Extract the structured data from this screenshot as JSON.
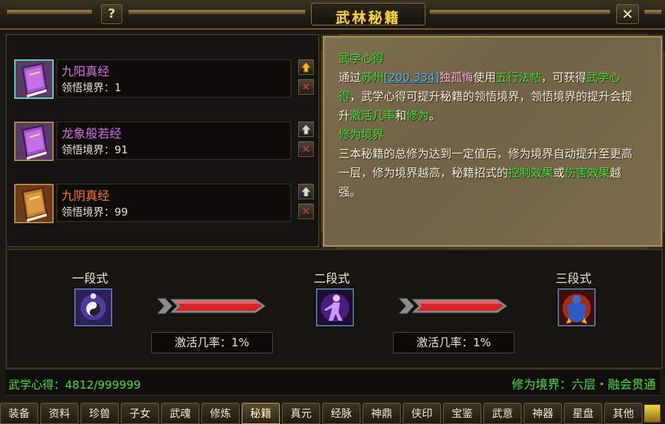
{
  "window": {
    "title": "武林秘籍",
    "help_label": "?",
    "close_label": "✕"
  },
  "books": [
    {
      "name": "九阳真经",
      "name_color": "#d86ee8",
      "level_label": "领悟境界：1",
      "icon": "purple-book-icon",
      "selected": true,
      "arrow": "up-arrow-gold"
    },
    {
      "name": "龙象般若经",
      "name_color": "#d86ee8",
      "level_label": "领悟境界：91",
      "icon": "purple-book-icon",
      "selected": false,
      "arrow": "up-arrow-grey"
    },
    {
      "name": "九阴真经",
      "name_color": "#ff7a1e",
      "level_label": "领悟境界：99",
      "icon": "orange-book-icon",
      "selected": false,
      "arrow": "up-arrow-grey"
    }
  ],
  "description": {
    "heading1": "武学心得",
    "p1_a": "通过",
    "p1_place": "苏州",
    "p1_coord": "[200,334]",
    "p1_npc": "独孤悔",
    "p1_b": "使用",
    "p1_item": "五行法帖",
    "p1_c": "，可获得",
    "p1_d": "武学心得",
    "p1_e": "，武学心得可提升秘籍的领悟境界，领悟境界的提升会提升",
    "p1_f": "激活几率",
    "p1_g": "和",
    "p1_h": "修为",
    "p1_i": "。",
    "heading2": "修为境界",
    "p2_a": "三本秘籍的总修为达到一定值后，修为境界自动提升至更高一层，修为境界越高，秘籍招式的",
    "p2_b": "控制效果",
    "p2_c": "或",
    "p2_d": "伤害效果",
    "p2_e": "越强。"
  },
  "stages": [
    {
      "label": "一段式",
      "icon": "yin-yang-meditation-icon"
    },
    {
      "label": "二段式",
      "icon": "purple-aura-figure-icon"
    },
    {
      "label": "三段式",
      "icon": "flaming-warrior-icon"
    }
  ],
  "rates": [
    "激活几率：1%",
    "激活几率：1%"
  ],
  "status": {
    "experience": "武学心得：4812/999999",
    "cultivation": "修为境界：六层・融会贯通"
  },
  "tabs": [
    "装备",
    "资料",
    "珍兽",
    "子女",
    "武魂",
    "修炼",
    "秘籍",
    "真元",
    "经脉",
    "神鼎",
    "侠印",
    "宝鉴",
    "武意",
    "神器",
    "星盘",
    "其他"
  ],
  "active_tab": "秘籍",
  "colors": {
    "accent_green": "#42e236",
    "title_gold": "#f2d64a",
    "link_blue": "#46b4f0"
  }
}
